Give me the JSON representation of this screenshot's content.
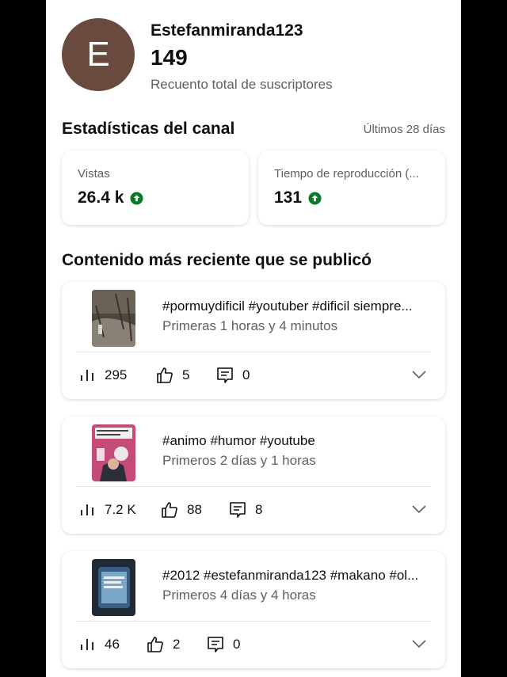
{
  "channel": {
    "avatar_letter": "E",
    "name": "Estefanmiranda123",
    "subscribers": "149",
    "subscribers_label": "Recuento total de suscriptores",
    "avatar_color": "#694a3f"
  },
  "stats": {
    "title": "Estadísticas del canal",
    "period": "Últimos 28 días",
    "views_label": "Vistas",
    "views_value": "26.4 k",
    "watch_label": "Tiempo de reproducción (...",
    "watch_value": "131",
    "trend_color": "#0b7a2a"
  },
  "recent": {
    "title": "Contenido más reciente que se publicó",
    "videos": [
      {
        "title": "#pormuydificil #youtuber #dificil siempre...",
        "time": "Primeras 1 horas y 4 minutos",
        "views": "295",
        "likes": "5",
        "comments": "0"
      },
      {
        "title": "#animo #humor #youtube",
        "time": "Primeros 2 días y 1 horas",
        "views": "7.2 K",
        "likes": "88",
        "comments": "8"
      },
      {
        "title": "#2012 #estefanmiranda123 #makano #ol...",
        "time": "Primeros 4 días y 4 horas",
        "views": "46",
        "likes": "2",
        "comments": "0"
      }
    ]
  }
}
